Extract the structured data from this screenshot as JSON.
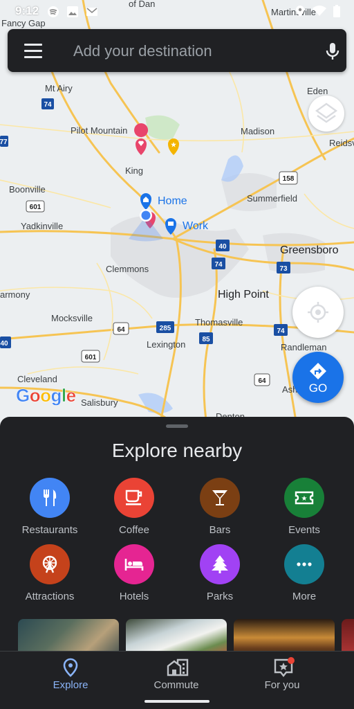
{
  "status_bar": {
    "time": "9:12"
  },
  "search": {
    "placeholder": "Add your destination"
  },
  "map": {
    "places": {
      "fancy_gap": "Fancy Gap",
      "martinsville": "Martinsville",
      "mt_airy": "Mt Airy",
      "eden": "Eden",
      "pilot_mountain": "Pilot Mountain",
      "madison": "Madison",
      "reidsv": "Reidsv",
      "king": "King",
      "boonville": "Boonville",
      "summerfield": "Summerfield",
      "yadkinville": "Yadkinville",
      "greensboro": "Greensboro",
      "clemmons": "Clemmons",
      "high_point": "High Point",
      "armony": "armony",
      "mocksville": "Mocksville",
      "thomasville": "Thomasville",
      "lexington": "Lexington",
      "randleman": "Randleman",
      "cleveland": "Cleveland",
      "salisbury": "Salisbury",
      "asheboro_partial": "Ash",
      "denton_partial": "Denton",
      "of_dan": "of Dan"
    },
    "pins": {
      "home": "Home",
      "work": "Work"
    },
    "shields": [
      "74",
      "77",
      "601",
      "158",
      "40",
      "74",
      "73",
      "285",
      "64",
      "85",
      "74",
      "601",
      "64",
      "40"
    ],
    "logo": "Google"
  },
  "buttons": {
    "go": "GO"
  },
  "explore": {
    "title": "Explore nearby",
    "categories": [
      {
        "label": "Restaurants",
        "color": "#4285f4",
        "icon": "restaurant-icon"
      },
      {
        "label": "Coffee",
        "color": "#ea4335",
        "icon": "coffee-icon"
      },
      {
        "label": "Bars",
        "color": "#7b3f13",
        "icon": "bar-icon"
      },
      {
        "label": "Events",
        "color": "#188038",
        "icon": "ticket-icon"
      },
      {
        "label": "Attractions",
        "color": "#c5421b",
        "icon": "ferris-wheel-icon"
      },
      {
        "label": "Hotels",
        "color": "#e52592",
        "icon": "hotel-icon"
      },
      {
        "label": "Parks",
        "color": "#a142f4",
        "icon": "tree-icon"
      },
      {
        "label": "More",
        "color": "#137f92",
        "icon": "more-icon"
      }
    ]
  },
  "nav": {
    "items": [
      {
        "label": "Explore",
        "active": true
      },
      {
        "label": "Commute",
        "active": false
      },
      {
        "label": "For you",
        "active": false
      }
    ]
  },
  "colors": {
    "accent": "#1a73e8",
    "sheet": "#202124",
    "active_nav": "#8ab4f8"
  }
}
